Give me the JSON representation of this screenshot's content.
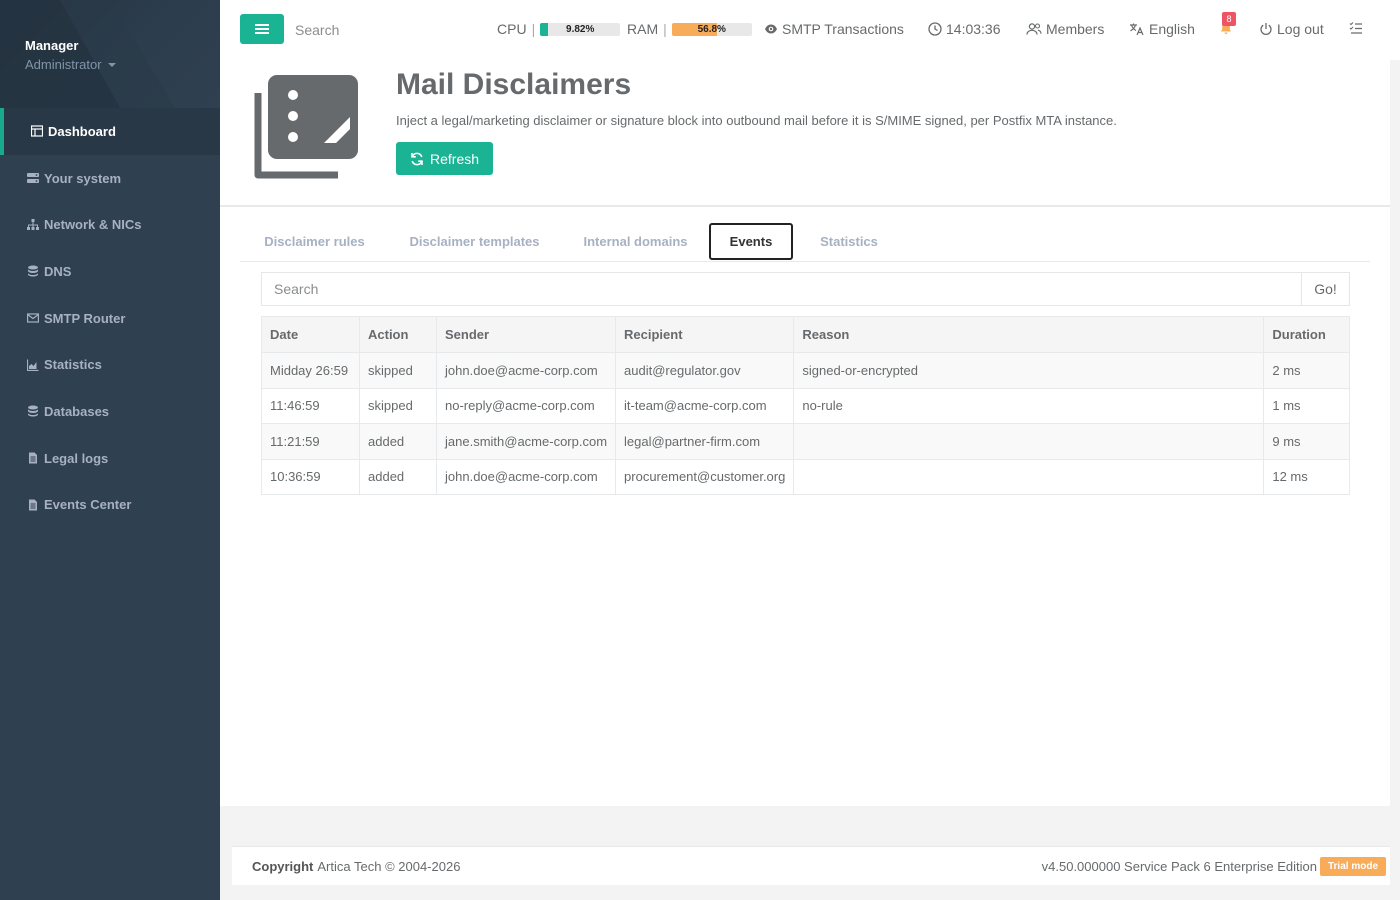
{
  "sidebar": {
    "profile_name": "Manager",
    "profile_role": "Administrator",
    "items": [
      {
        "label": "Dashboard",
        "icon": "dashboard-icon"
      },
      {
        "label": "Your system",
        "icon": "server-icon"
      },
      {
        "label": "Network & NICs",
        "icon": "network-icon"
      },
      {
        "label": "DNS",
        "icon": "database-icon"
      },
      {
        "label": "SMTP Router",
        "icon": "envelope-icon"
      },
      {
        "label": "Statistics",
        "icon": "chart-icon"
      },
      {
        "label": "Databases",
        "icon": "database-icon"
      },
      {
        "label": "Legal logs",
        "icon": "file-icon"
      },
      {
        "label": "Events Center",
        "icon": "file-icon"
      }
    ]
  },
  "topbar": {
    "search_placeholder": "Search",
    "cpu_label": "CPU",
    "cpu_value": "9.82%",
    "cpu_fraction": 0.0982,
    "ram_label": "RAM",
    "ram_value": "56.8%",
    "ram_fraction": 0.568,
    "smtp_label": "SMTP Transactions",
    "clock": "14:03:36",
    "members_label": "Members",
    "language_label": "English",
    "notifications_count": "8",
    "logout_label": "Log out",
    "colors": {
      "accent": "#1ab394",
      "cpu": "#1ab394",
      "ram": "#f8ac59",
      "badge": "#ed5565"
    }
  },
  "header": {
    "title": "Mail Disclaimers",
    "description": "Inject a legal/marketing disclaimer or signature block into outbound mail before it is S/MIME signed, per Postfix MTA instance.",
    "refresh_label": "Refresh"
  },
  "tabs": [
    {
      "label": "Disclaimer rules",
      "active": false
    },
    {
      "label": "Disclaimer templates",
      "active": false
    },
    {
      "label": "Internal domains",
      "active": false
    },
    {
      "label": "Events",
      "active": true
    },
    {
      "label": "Statistics",
      "active": false
    }
  ],
  "search": {
    "placeholder": "Search",
    "go_label": "Go!"
  },
  "table": {
    "columns": [
      "Date",
      "Action",
      "Sender",
      "Recipient",
      "Reason",
      "Duration"
    ],
    "rows": [
      [
        "Midday 26:59",
        "skipped",
        "john.doe@acme-corp.com",
        "audit@regulator.gov",
        "signed-or-encrypted",
        "2 ms"
      ],
      [
        "11:46:59",
        "skipped",
        "no-reply@acme-corp.com",
        "it-team@acme-corp.com",
        "no-rule",
        "1 ms"
      ],
      [
        "11:21:59",
        "added",
        "jane.smith@acme-corp.com",
        "legal@partner-firm.com",
        "",
        "9 ms"
      ],
      [
        "10:36:59",
        "added",
        "john.doe@acme-corp.com",
        "procurement@customer.org",
        "",
        "12 ms"
      ]
    ]
  },
  "footer": {
    "copyright_label": "Copyright",
    "copyright_text": "Artica Tech © 2004-2026",
    "version": "v4.50.000000 Service Pack 6 Enterprise Edition",
    "trial_label": "Trial mode"
  }
}
